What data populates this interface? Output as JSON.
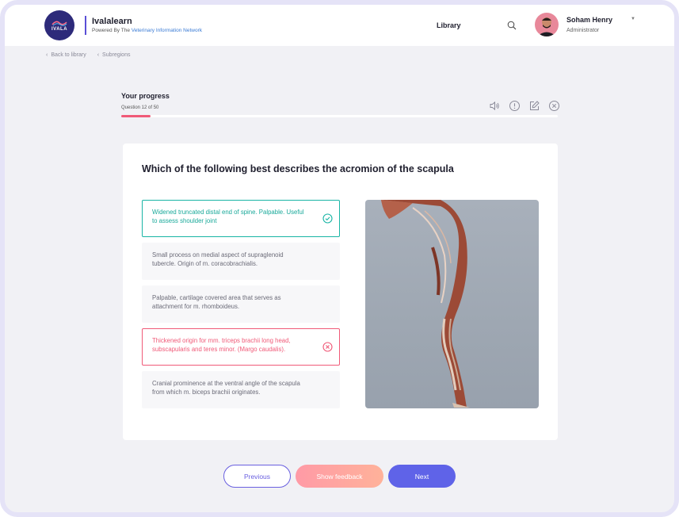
{
  "header": {
    "logo_text": "IVALA",
    "brand_title": "Ivalalearn",
    "brand_sub_prefix": "Powered By The",
    "brand_sub_link": "Veterinary Information Network",
    "nav_library": "Library",
    "user_name": "Soham Henry",
    "user_role": "Administrator"
  },
  "breadcrumb": [
    {
      "label": "Back to library"
    },
    {
      "label": "Subregions"
    }
  ],
  "progress": {
    "title": "Your progress",
    "subtitle": "Question 12 of 50",
    "fraction": 0.067
  },
  "question": "Which of the following best describes the acromion of the scapula",
  "options": [
    {
      "text": "Widened truncated distal end of spine. Palpable. Useful to assess shoulder joint",
      "state": "correct"
    },
    {
      "text": "Small process on medial aspect of supraglenoid tubercle. Origin of m. coracobrachialis.",
      "state": "neutral"
    },
    {
      "text": "Palpable, cartilage covered area that serves as attachment for m. rhomboideus.",
      "state": "neutral"
    },
    {
      "text": "Thickened origin for mm. triceps brachii long head, subscapularis and teres minor. (Margo caudalis).",
      "state": "wrong"
    },
    {
      "text": "Cranial prominence at the ventral angle of the scapula from which m. biceps brachii originates.",
      "state": "neutral"
    }
  ],
  "buttons": {
    "previous": "Previous",
    "feedback": "Show feedback",
    "next": "Next"
  },
  "colors": {
    "accent": "#5f63e8",
    "correct": "#19b5a5",
    "wrong": "#f05a78",
    "progress": "#f05a78"
  }
}
